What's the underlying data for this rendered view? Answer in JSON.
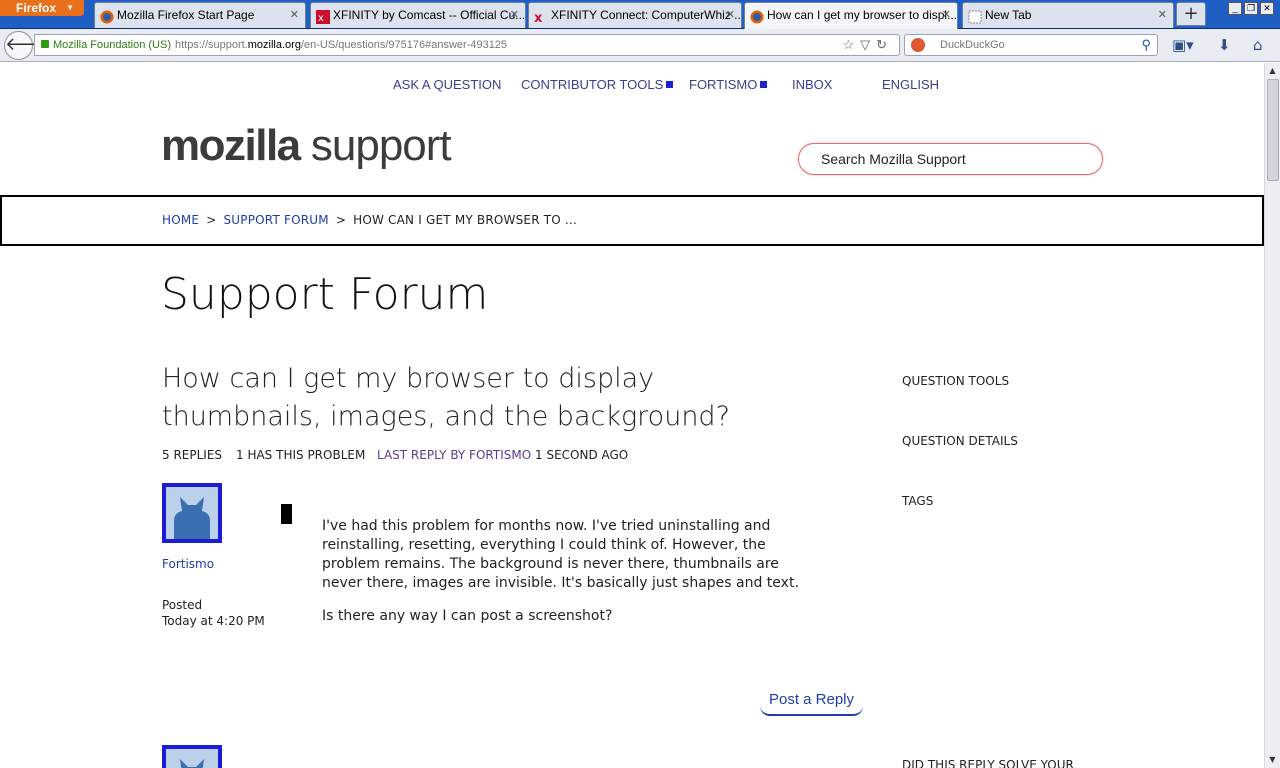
{
  "browser": {
    "app_button": "Firefox",
    "tabs": [
      {
        "title": "Mozilla Firefox Start Page"
      },
      {
        "title": "XFINITY by Comcast -- Official Cu..."
      },
      {
        "title": "XFINITY Connect: ComputerWhiz ..."
      },
      {
        "title": "How can I get my browser to displ..."
      },
      {
        "title": "New Tab"
      }
    ],
    "identity": "Mozilla Foundation (US)",
    "url_prefix": "https://support.",
    "url_domain": "mozilla.org",
    "url_path": "/en-US/questions/975176#answer-493125",
    "search_placeholder": "DuckDuckGo"
  },
  "topnav": {
    "ask": "ASK A QUESTION",
    "contributor": "CONTRIBUTOR TOOLS",
    "user": "FORTISMO",
    "inbox": "INBOX",
    "language": "ENGLISH"
  },
  "logo": {
    "bold": "mozilla",
    "light": "support"
  },
  "site_search": {
    "placeholder": "Search Mozilla Support"
  },
  "breadcrumb": {
    "home": "HOME",
    "sep": ">",
    "forum": "SUPPORT FORUM",
    "current": "HOW CAN I GET MY BROWSER TO ..."
  },
  "page_title": "Support Forum",
  "question": {
    "title": "How can I get my browser to display thumbnails, images, and the background?",
    "replies": "5 REPLIES",
    "has_problem": "1 HAS THIS PROBLEM",
    "last_reply": "LAST REPLY BY FORTISMO",
    "last_time": "1 SECOND AGO",
    "author": "Fortismo",
    "posted_label": "Posted",
    "posted_value": "Today at 4:20 PM",
    "body_1": "I've had this problem for months now. I've tried uninstalling and reinstalling, resetting, everything I could think of. However, the problem remains. The background is never there, thumbnails are never there, images are invisible. It's basically just shapes and text.",
    "body_2": "Is there any way I can post a screenshot?",
    "reply_button": "Post a Reply"
  },
  "sidebar": {
    "tools": "QUESTION TOOLS",
    "details": "QUESTION DETAILS",
    "tags": "TAGS",
    "cut_off": "DID THIS REPLY SOLVE YOUR"
  },
  "colors": {
    "link": "#1e3ea8",
    "accent_square": "#1a22d8",
    "search_border": "#e56c6c",
    "tabbar": "#1f5fc4",
    "firefox_button": "#e8701a"
  }
}
